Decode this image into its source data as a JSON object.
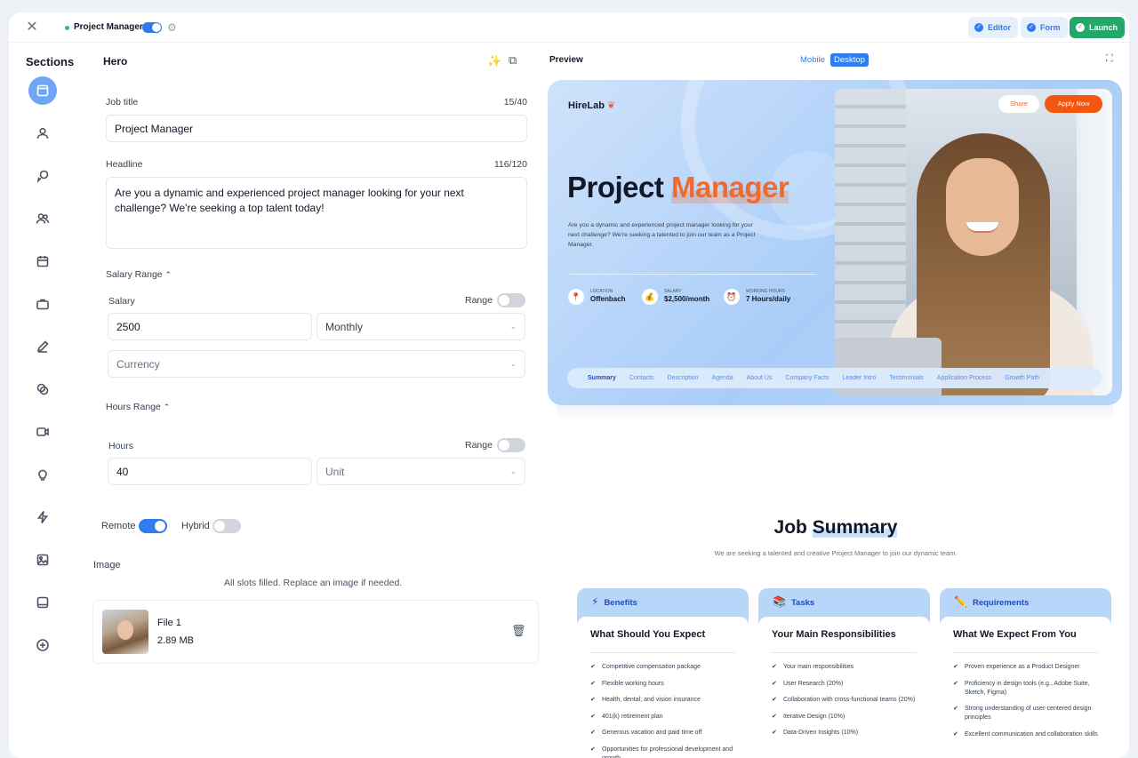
{
  "topbar": {
    "project_name": "Project Manager",
    "editor_label": "Editor",
    "form_label": "Form",
    "launch_label": "Launch"
  },
  "sections": {
    "title": "Sections",
    "icons": [
      "hero-icon",
      "user-icon",
      "chat-icon",
      "team-icon",
      "calendar-icon",
      "briefcase-icon",
      "pen-icon",
      "circles-icon",
      "video-icon",
      "lightbulb-icon",
      "bolt-icon",
      "image-icon",
      "tablet-icon",
      "add-icon"
    ]
  },
  "editor": {
    "section_title": "Hero",
    "job_title_label": "Job title",
    "job_title_counter": "15/40",
    "job_title_value": "Project Manager",
    "headline_label": "Headline",
    "headline_counter": "116/120",
    "headline_value": "Are you a dynamic and experienced project manager looking for your next challenge? We're seeking a top talent today!",
    "salary_range_label": "Salary Range",
    "salary_label": "Salary",
    "range_label": "Range",
    "salary_value": "2500",
    "salary_period": "Monthly",
    "currency_placeholder": "Currency",
    "hours_range_label": "Hours Range",
    "hours_label": "Hours",
    "hours_value": "40",
    "unit_placeholder": "Unit",
    "remote_label": "Remote",
    "hybrid_label": "Hybrid",
    "image_label": "Image",
    "image_note": "All slots filled. Replace an image if needed.",
    "file_name": "File 1",
    "file_size": "2.89 MB"
  },
  "preview": {
    "label": "Preview",
    "mobile_label": "Mobile",
    "desktop_label": "Desktop",
    "brand": "HireLab",
    "share_label": "Share",
    "apply_label": "Apply Now",
    "title_part1": "Project",
    "title_part2": "Manager",
    "description": "Are you a dynamic and experienced project manager looking for your next challenge? We're seeking a talented to join our team as a Project Manager.",
    "stats": [
      {
        "label": "LOCATION",
        "value": "Offenbach",
        "icon": "pin-icon"
      },
      {
        "label": "SALARY",
        "value": "$2,500/month",
        "icon": "money-bag-icon"
      },
      {
        "label": "WORKING HOURS",
        "value": "7 Hours/daily",
        "icon": "clock-icon"
      }
    ],
    "nav": [
      "Summary",
      "Contacts",
      "Description",
      "Agenda",
      "About Us",
      "Company Facts",
      "Leader Intro",
      "Testimonials",
      "Application Process",
      "Growth Path"
    ],
    "summary_title_part1": "Job",
    "summary_title_part2": "Summary",
    "summary_subtitle": "We are seeking a talented and creative Project Manager to join our dynamic team.",
    "cards": [
      {
        "tab": "Benefits",
        "icon": "lightning-icon",
        "heading": "What Should You Expect",
        "items": [
          "Competitive compensation package",
          "Flexible working hours",
          "Health, dental, and vision insurance",
          "401(k) retirement plan",
          "Generous vacation and paid time off",
          "Opportunities for professional development and growth"
        ]
      },
      {
        "tab": "Tasks",
        "icon": "books-icon",
        "heading": "Your Main Responsibilities",
        "items": [
          "Your main responsibilities",
          "User Research (20%)",
          "Collaboration with cross-functional teams (20%)",
          "Iterative Design (10%)",
          "Data-Driven Insights (10%)"
        ]
      },
      {
        "tab": "Requirements",
        "icon": "pencil-icon",
        "heading": "What We Expect From You",
        "items": [
          "Proven experience as a Product Designer",
          "Proficiency in design tools (e.g., Adobe Suite, Sketch, Figma)",
          "Strong understanding of user-centered design principles",
          "Excellent communication and collaboration skills"
        ]
      }
    ]
  },
  "colors": {
    "accent": "#2f7bf0",
    "launch": "#22a96a",
    "brand_orange": "#f26a2b"
  }
}
